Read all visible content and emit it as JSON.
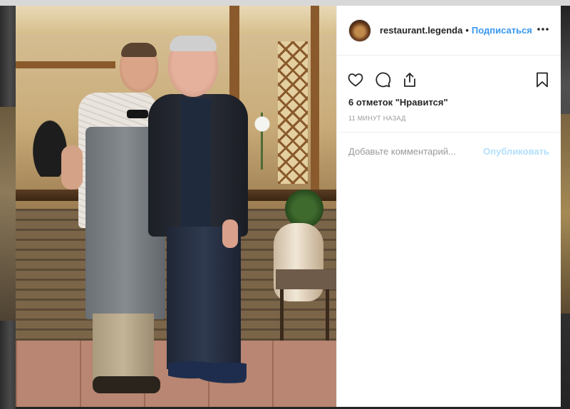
{
  "post": {
    "username": "restaurant.legenda",
    "separator": "•",
    "follow_label": "Подписаться",
    "more_label": "•••",
    "likes_text": "6 отметок \"Нравится\"",
    "time_text": "11 МИНУТ НАЗАД"
  },
  "comment": {
    "placeholder": "Добавьте комментарий...",
    "publish_label": "Опубликовать"
  },
  "icons": {
    "like": "heart-icon",
    "comment": "comment-icon",
    "share": "share-icon",
    "save": "bookmark-icon",
    "more": "more-options-icon"
  },
  "colors": {
    "link": "#3897f0",
    "publish_disabled": "#b2dffc",
    "muted": "#999999",
    "text": "#262626"
  }
}
